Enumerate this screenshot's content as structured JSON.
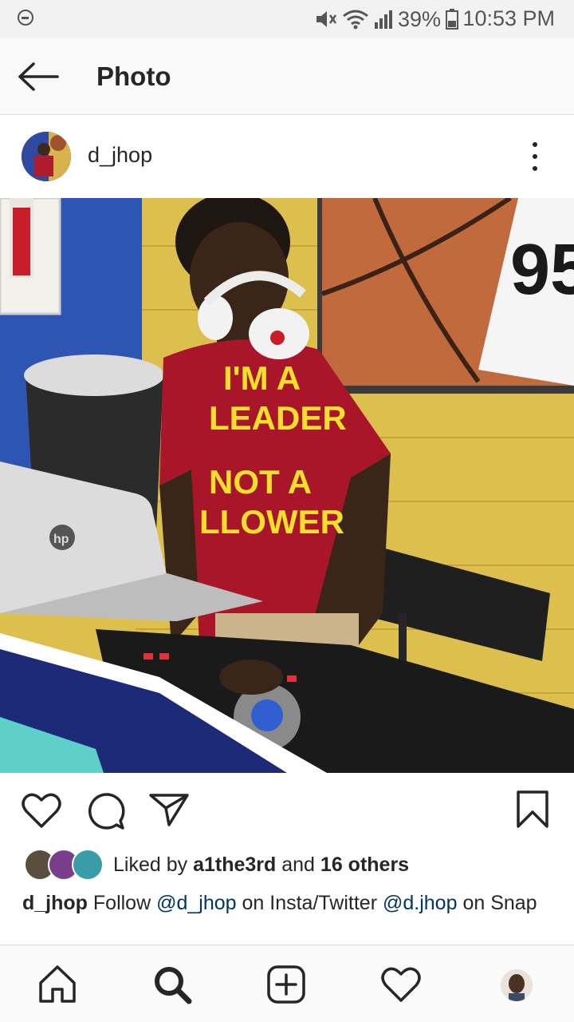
{
  "status_bar": {
    "battery": "39%",
    "time": "10:53 PM"
  },
  "app_bar": {
    "title": "Photo"
  },
  "post": {
    "username": "d_jhop",
    "photo": {
      "shirt_line1": "I'M A",
      "shirt_line2": "LEADER",
      "shirt_line3": "NOT A",
      "shirt_line4": "LLOWER",
      "sign_text": "95",
      "laptop_brand": "hp"
    },
    "likes": {
      "prefix": "Liked by",
      "user": "a1the3rd",
      "middle": "and",
      "others": "16 others"
    },
    "caption": {
      "username": "d_jhop",
      "text1": "Follow",
      "mention1": "@d_jhop",
      "text2": "on Insta/Twitter",
      "mention2": "@d.jhop",
      "text3": "on Snap"
    }
  },
  "bottom_nav": {
    "items": [
      "home-icon",
      "search-icon",
      "new-post-icon",
      "activity-icon",
      "profile-avatar"
    ]
  },
  "colors": {
    "text": "#262626",
    "mention": "#003569",
    "statusbar_bg": "#f2f2f2"
  }
}
